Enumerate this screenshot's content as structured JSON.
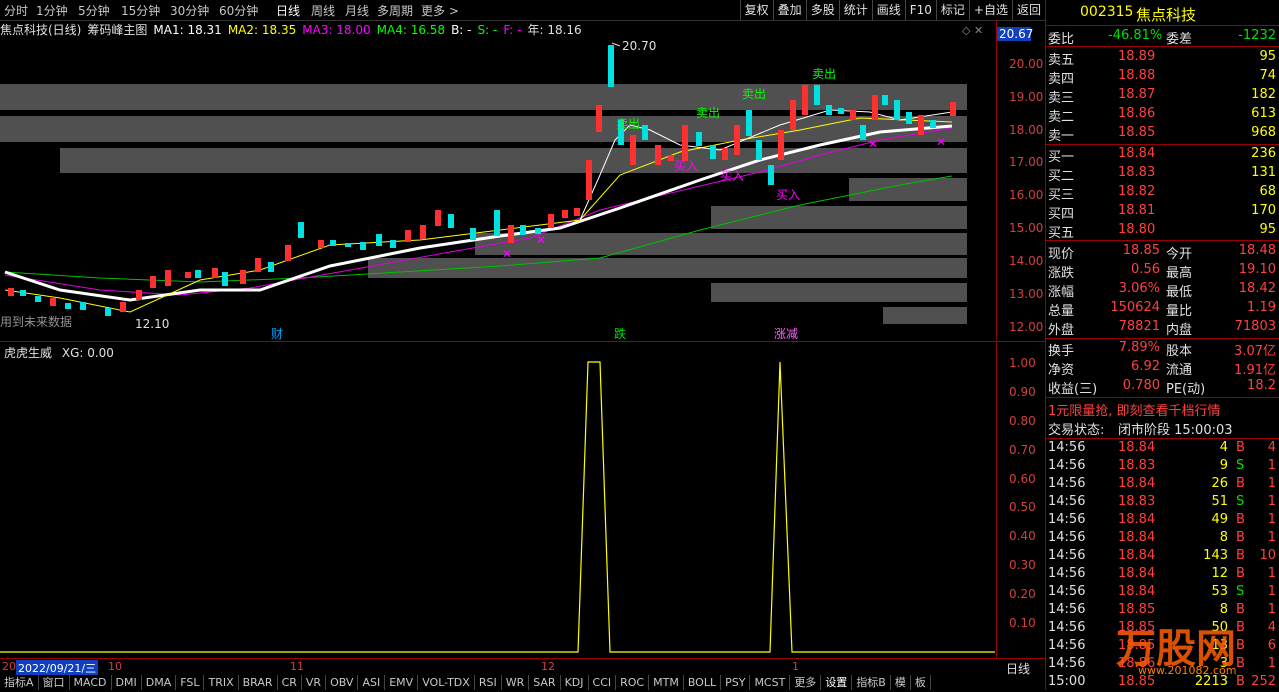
{
  "toolbar": {
    "periods": [
      "分时",
      "1分钟",
      "5分钟",
      "15分钟",
      "30分钟",
      "60分钟",
      "日线",
      "周线",
      "月线",
      "多周期",
      "更多 >"
    ],
    "active": "日线",
    "right_buttons": [
      "复权",
      "叠加",
      "多股",
      "统计",
      "画线",
      "F10",
      "标记",
      "+自选",
      "返回"
    ]
  },
  "info": {
    "name": "焦点科技(日线)",
    "indicator": "筹码峰主图",
    "ma1": "MA1: 18.31",
    "ma2": "MA2: 18.35",
    "ma3": "MA3: 18.00",
    "ma4": "MA4: 16.58",
    "b": "B: -",
    "s": "S: -",
    "f": "F: -",
    "year": "年: 18.16",
    "ma1_color": "#ffffff",
    "ma2_color": "#ffff00",
    "ma3_color": "#ff00ff",
    "ma4_color": "#00ff00"
  },
  "main_y_ticks": [
    "20.67",
    "20.00",
    "19.00",
    "18.00",
    "17.00",
    "16.00",
    "15.00",
    "14.00",
    "13.00",
    "12.00"
  ],
  "main_labels": {
    "high": "20.70",
    "low": "12.10",
    "future": "用到未来数据",
    "sells": [
      "卖出",
      "卖出",
      "卖出",
      "卖出"
    ],
    "buys": [
      "买入",
      "买入",
      "买入"
    ],
    "events": [
      "财",
      "跌",
      "涨减"
    ]
  },
  "sub": {
    "title": "虎虎生威",
    "xg": "XG: 0.00",
    "y_ticks": [
      "1.00",
      "0.90",
      "0.80",
      "0.70",
      "0.60",
      "0.50",
      "0.40",
      "0.30",
      "0.20",
      "0.10"
    ]
  },
  "datebar": {
    "date": "2022/09/21/三",
    "months": [
      "20",
      "10",
      "11",
      "12",
      "1"
    ],
    "period": "日线"
  },
  "tabs": [
    "指标A",
    "窗口",
    "MACD",
    "DMI",
    "DMA",
    "FSL",
    "TRIX",
    "BRAR",
    "CR",
    "VR",
    "OBV",
    "ASI",
    "EMV",
    "VOL-TDX",
    "RSI",
    "WR",
    "SAR",
    "KDJ",
    "CCI",
    "ROC",
    "MTM",
    "BOLL",
    "PSY",
    "MCST",
    "更多",
    "设置",
    "指标B",
    "模",
    "板"
  ],
  "quote": {
    "code": "002315",
    "name": "焦点科技",
    "weibi_label": "委比",
    "weibi": "-46.81%",
    "weicha_label": "委差",
    "weicha": "-1232",
    "asks": [
      {
        "label": "卖五",
        "price": "18.89",
        "vol": "95"
      },
      {
        "label": "卖四",
        "price": "18.88",
        "vol": "74"
      },
      {
        "label": "卖三",
        "price": "18.87",
        "vol": "182"
      },
      {
        "label": "卖二",
        "price": "18.86",
        "vol": "613"
      },
      {
        "label": "卖一",
        "price": "18.85",
        "vol": "968"
      }
    ],
    "bids": [
      {
        "label": "买一",
        "price": "18.84",
        "vol": "236"
      },
      {
        "label": "买二",
        "price": "18.83",
        "vol": "131"
      },
      {
        "label": "买三",
        "price": "18.82",
        "vol": "68"
      },
      {
        "label": "买四",
        "price": "18.81",
        "vol": "170"
      },
      {
        "label": "买五",
        "price": "18.80",
        "vol": "95"
      }
    ],
    "stats": [
      {
        "l1": "现价",
        "v1": "18.85",
        "l2": "今开",
        "v2": "18.48"
      },
      {
        "l1": "涨跌",
        "v1": "0.56",
        "l2": "最高",
        "v2": "19.10"
      },
      {
        "l1": "涨幅",
        "v1": "3.06%",
        "l2": "最低",
        "v2": "18.42"
      },
      {
        "l1": "总量",
        "v1": "150624",
        "l2": "量比",
        "v2": "1.19"
      },
      {
        "l1": "外盘",
        "v1": "78821",
        "l2": "内盘",
        "v2": "71803"
      }
    ],
    "stats2": [
      {
        "l1": "换手",
        "v1": "7.89%",
        "l2": "股本",
        "v2": "3.07亿"
      },
      {
        "l1": "净资",
        "v1": "6.92",
        "l2": "流通",
        "v2": "1.91亿"
      },
      {
        "l1": "收益(三)",
        "v1": "0.780",
        "l2": "PE(动)",
        "v2": "18.2"
      }
    ],
    "ad": "1元限量抢, 即刻查看千档行情",
    "status_label": "交易状态:",
    "status": "闭市阶段 15:00:03",
    "trades": [
      {
        "t": "14:56",
        "p": "18.84",
        "v": "4",
        "bs": "B"
      },
      {
        "t": "14:56",
        "p": "18.83",
        "v": "9",
        "bs": "S"
      },
      {
        "t": "14:56",
        "p": "18.84",
        "v": "26",
        "bs": "B"
      },
      {
        "t": "14:56",
        "p": "18.83",
        "v": "51",
        "bs": "S"
      },
      {
        "t": "14:56",
        "p": "18.84",
        "v": "49",
        "bs": "B"
      },
      {
        "t": "14:56",
        "p": "18.84",
        "v": "8",
        "bs": "B"
      },
      {
        "t": "14:56",
        "p": "18.84",
        "v": "143",
        "bs": "B"
      },
      {
        "t": "14:56",
        "p": "18.84",
        "v": "12",
        "bs": "B"
      },
      {
        "t": "14:56",
        "p": "18.84",
        "v": "53",
        "bs": "S"
      },
      {
        "t": "14:56",
        "p": "18.85",
        "v": "8",
        "bs": "B"
      },
      {
        "t": "14:56",
        "p": "18.85",
        "v": "50",
        "bs": "B"
      },
      {
        "t": "14:56",
        "p": "18.85",
        "v": "13",
        "bs": "B"
      },
      {
        "t": "14:56",
        "p": "18.86",
        "v": "3",
        "bs": "B"
      },
      {
        "t": "15:00",
        "p": "18.85",
        "v": "2213",
        "bs": "B"
      }
    ],
    "trade_extra": [
      "4",
      "1",
      "1",
      "1",
      "1",
      "1",
      "10",
      "1",
      "1",
      "1",
      "4",
      "6",
      "1",
      "252"
    ]
  },
  "watermark": {
    "text": "万股网",
    "url": "www.201082.com"
  }
}
